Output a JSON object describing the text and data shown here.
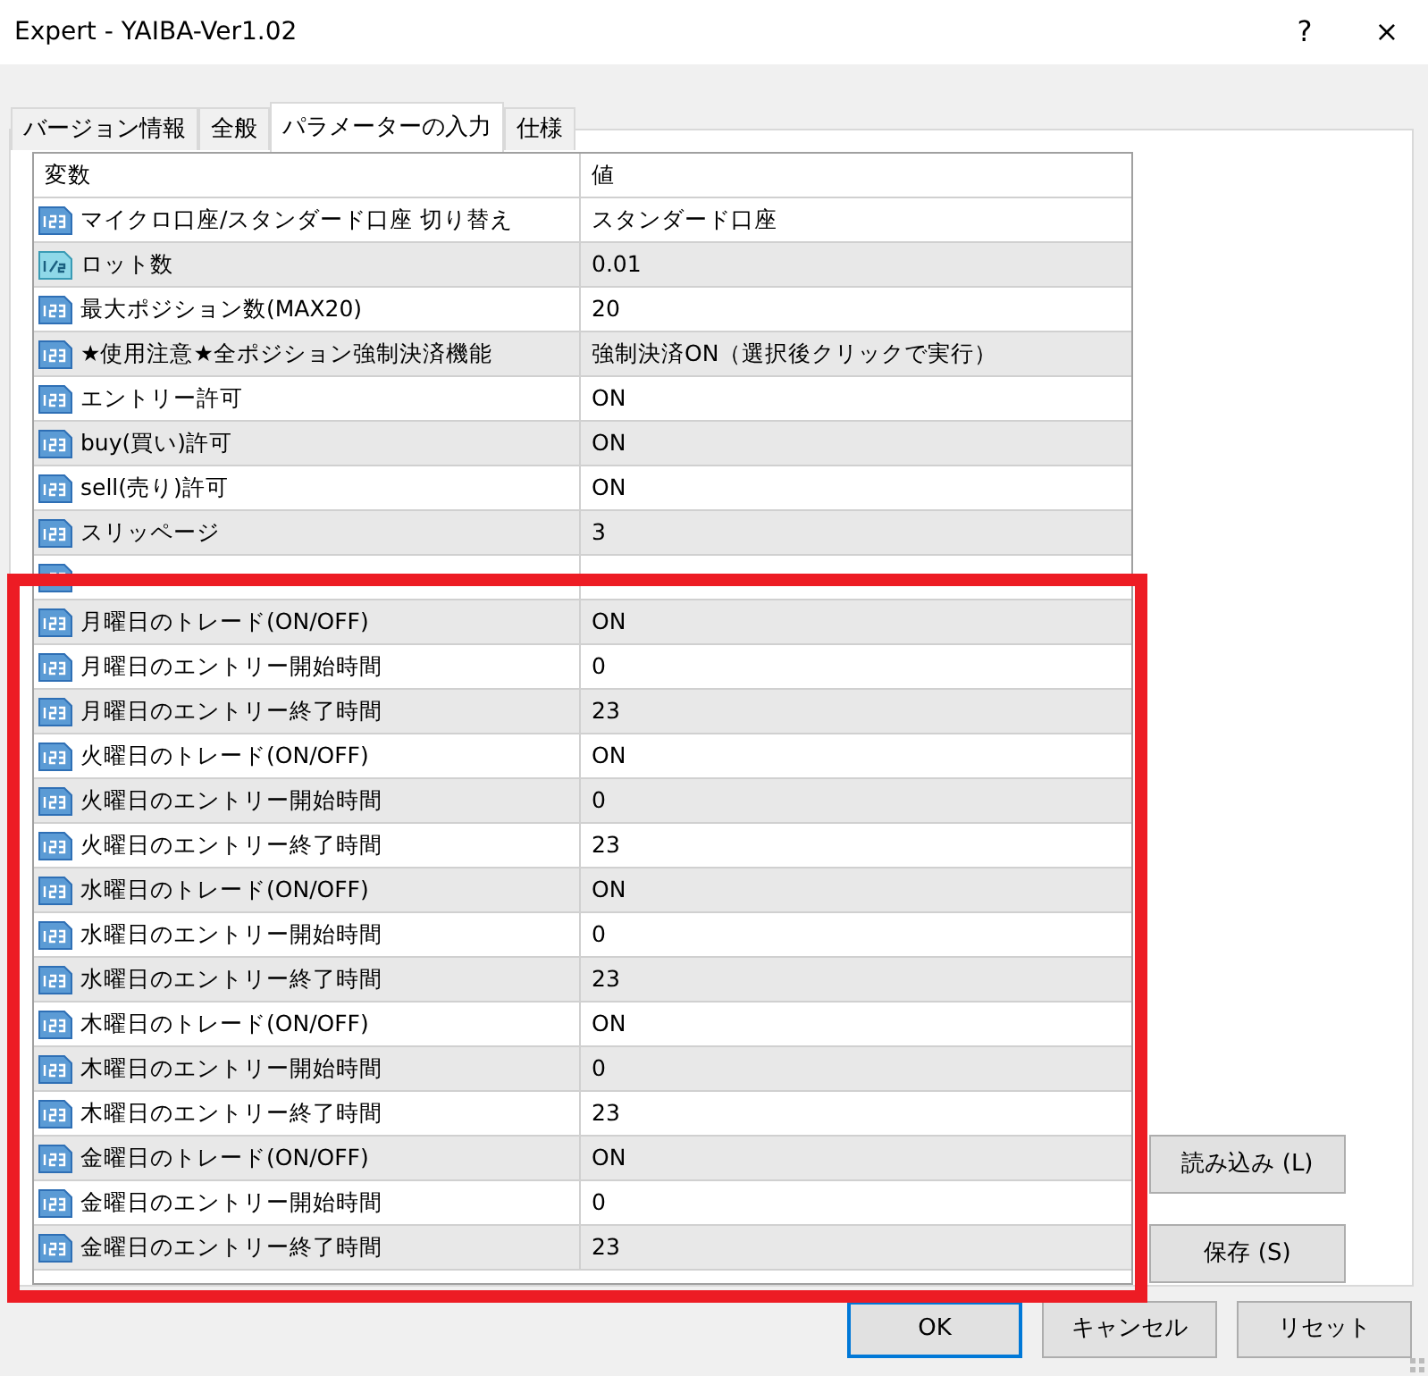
{
  "window": {
    "title": "Expert - YAIBA-Ver1.02",
    "help": "?",
    "close": "×"
  },
  "tabs": [
    {
      "label": "バージョン情報",
      "selected": false
    },
    {
      "label": "全般",
      "selected": false
    },
    {
      "label": "パラメーターの入力",
      "selected": true
    },
    {
      "label": "仕様",
      "selected": false
    }
  ],
  "table": {
    "columns": [
      "変数",
      "値"
    ],
    "rows": [
      {
        "kind": "int",
        "name": "マイクロ口座/スタンダード口座 切り替え",
        "value": "スタンダード口座"
      },
      {
        "kind": "double",
        "name": "ロット数",
        "value": "0.01"
      },
      {
        "kind": "int",
        "name": "最大ポジション数(MAX20)",
        "value": "20"
      },
      {
        "kind": "int",
        "name": "★使用注意★全ポジション強制決済機能",
        "value": "強制決済ON（選択後クリックで実行）"
      },
      {
        "kind": "int",
        "name": "エントリー許可",
        "value": "ON"
      },
      {
        "kind": "int",
        "name": "buy(買い)許可",
        "value": "ON"
      },
      {
        "kind": "int",
        "name": "sell(売り)許可",
        "value": "ON"
      },
      {
        "kind": "int",
        "name": "スリッページ",
        "value": "3"
      },
      {
        "kind": "int"
      },
      {
        "kind": "int",
        "name": "月曜日のトレード(ON/OFF)",
        "value": "ON"
      },
      {
        "kind": "int",
        "name": "月曜日のエントリー開始時間",
        "value": "0"
      },
      {
        "kind": "int",
        "name": "月曜日のエントリー終了時間",
        "value": "23"
      },
      {
        "kind": "int",
        "name": "火曜日のトレード(ON/OFF)",
        "value": "ON"
      },
      {
        "kind": "int",
        "name": "火曜日のエントリー開始時間",
        "value": "0"
      },
      {
        "kind": "int",
        "name": "火曜日のエントリー終了時間",
        "value": "23"
      },
      {
        "kind": "int",
        "name": "水曜日のトレード(ON/OFF)",
        "value": "ON"
      },
      {
        "kind": "int",
        "name": "水曜日のエントリー開始時間",
        "value": "0"
      },
      {
        "kind": "int",
        "name": "水曜日のエントリー終了時間",
        "value": "23"
      },
      {
        "kind": "int",
        "name": "木曜日のトレード(ON/OFF)",
        "value": "ON"
      },
      {
        "kind": "int",
        "name": "木曜日のエントリー開始時間",
        "value": "0"
      },
      {
        "kind": "int",
        "name": "木曜日のエントリー終了時間",
        "value": "23"
      },
      {
        "kind": "int",
        "name": "金曜日のトレード(ON/OFF)",
        "value": "ON"
      },
      {
        "kind": "int",
        "name": "金曜日のエントリー開始時間",
        "value": "0"
      },
      {
        "kind": "int",
        "name": "金曜日のエントリー終了時間",
        "value": "23"
      }
    ]
  },
  "side_buttons": [
    "読み込み (L)",
    "保存 (S)"
  ],
  "buttons": [
    {
      "label": "OK",
      "selected": true
    },
    {
      "label": "キャンセル",
      "selected": false
    },
    {
      "label": "リセット",
      "selected": false
    }
  ]
}
